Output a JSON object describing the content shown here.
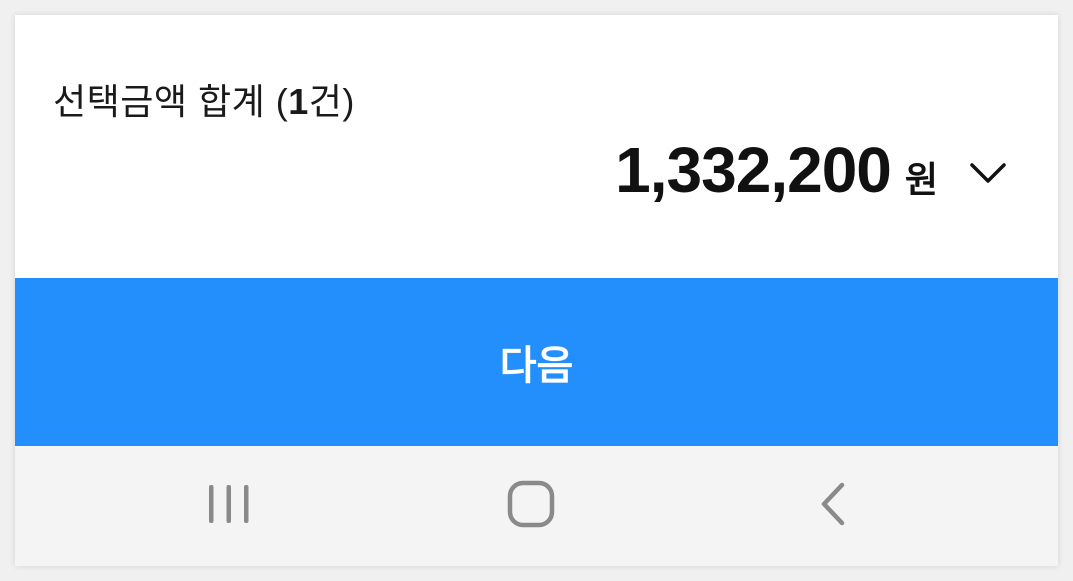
{
  "summary": {
    "label_prefix": "선택금액 합계 (",
    "label_count": "1",
    "label_suffix": "건)",
    "total_amount": "1,332,200",
    "currency_unit": "원",
    "expand_icon": "chevron-down-icon"
  },
  "action": {
    "next_label": "다음",
    "color": "#228ffd"
  },
  "system_nav": {
    "recents_icon": "recents-icon",
    "home_icon": "home-icon",
    "back_icon": "back-icon"
  }
}
